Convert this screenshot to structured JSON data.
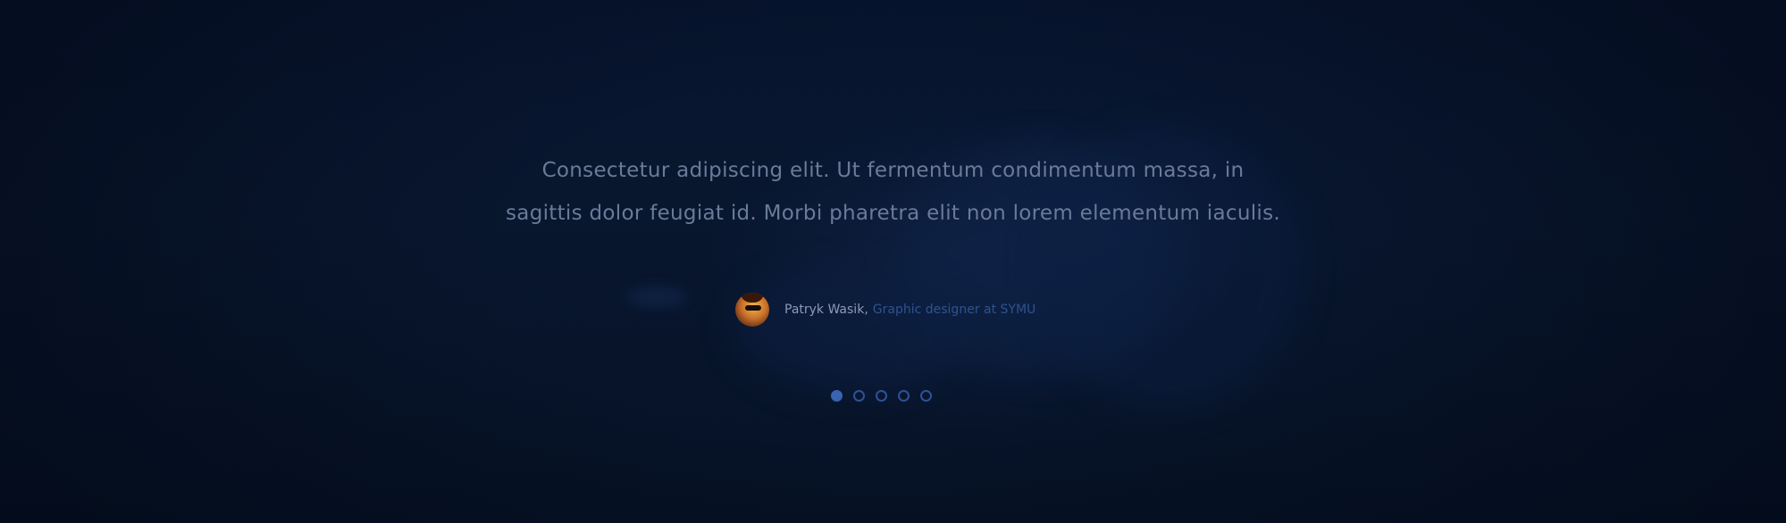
{
  "testimonial": {
    "quote_line1": "Consectetur adipiscing elit. Ut fermentum condimentum massa, in",
    "quote_line2": "sagittis dolor feugiat id. Morbi pharetra elit non lorem elementum iaculis.",
    "author_name": "Patryk Wasik",
    "author_separator": ",",
    "author_role": "Graphic designer at SYMU",
    "avatar_icon": "person-with-sunglasses-avatar"
  },
  "pagination": {
    "total": 5,
    "active_index": 0,
    "dots": [
      {
        "label": "slide-1",
        "active": true
      },
      {
        "label": "slide-2",
        "active": false
      },
      {
        "label": "slide-3",
        "active": false
      },
      {
        "label": "slide-4",
        "active": false
      },
      {
        "label": "slide-5",
        "active": false
      }
    ]
  },
  "colors": {
    "background": "#08142a",
    "quote_text": "#6a7b99",
    "author_name": "#8d9ab2",
    "author_role": "#2f528e",
    "dot_accent": "#3a63b0"
  }
}
